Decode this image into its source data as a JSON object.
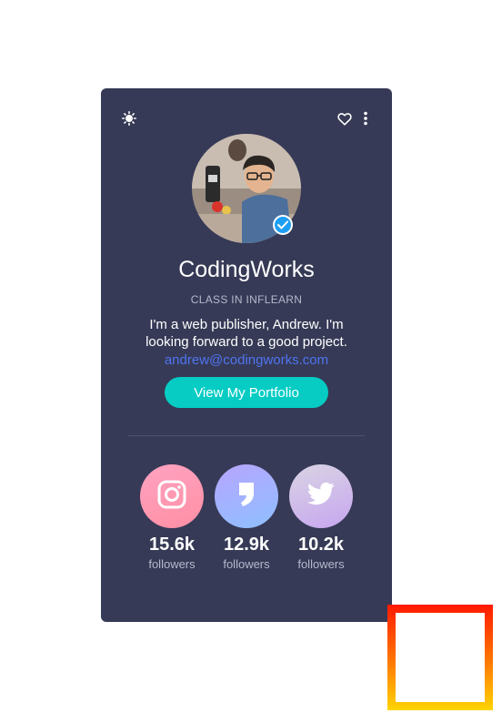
{
  "profile": {
    "name": "CodingWorks",
    "subtitle": "CLASS IN INFLEARN",
    "bio": "I'm a web publisher, Andrew. I'm looking forward to a good project.",
    "email": "andrew@codingworks.com",
    "button_label": "View My Portfolio"
  },
  "social": [
    {
      "icon": "instagram-icon",
      "count": "15.6k",
      "label": "followers"
    },
    {
      "icon": "quote-icon",
      "count": "12.9k",
      "label": "followers"
    },
    {
      "icon": "twitter-icon",
      "count": "10.2k",
      "label": "followers"
    }
  ],
  "colors": {
    "card_bg": "#363a56",
    "accent_button": "#06ccc4",
    "link": "#4f74f0",
    "verified": "#1e9ef5"
  }
}
